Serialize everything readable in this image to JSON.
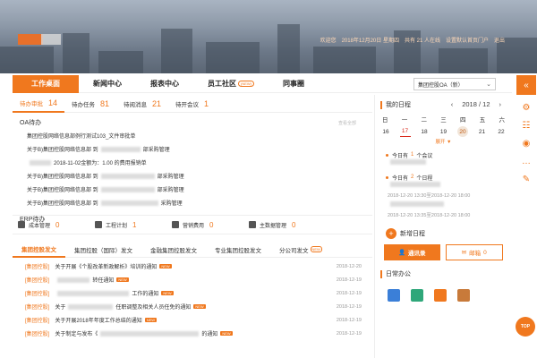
{
  "header": {
    "welcome": "欢迎您",
    "date": "2018年12月20日 星期四",
    "online": "共有 21 人在线",
    "set_home": "设置默认首页门户",
    "logout": "退出"
  },
  "nav": {
    "items": [
      "工作桌面",
      "新闻中心",
      "报表中心",
      "员工社区",
      "同事圈"
    ],
    "badge": "(NEW)",
    "org_select": "集团控股OA（新）"
  },
  "todo": {
    "tabs": [
      {
        "label": "待办审批",
        "count": "14"
      },
      {
        "label": "待办任务",
        "count": "81"
      },
      {
        "label": "待阅消息",
        "count": "21"
      },
      {
        "label": "待开会议",
        "count": "1"
      }
    ],
    "oa_title": "OA待办",
    "more": "查看全部",
    "oa_rows": [
      "集团控股网络信息部例行测试103_文件审批单",
      "关于B)集团控股网络信息部 到",
      "部采购管理",
      "2018-11-02金额为：1.00 的费用报销单",
      "关于B)集团控股网络信息部 到",
      "部采购管理",
      "关于B)集团控股网络信息部 到",
      "部采购管理",
      "关于B)集团控股网络信息部 到",
      "采购管理"
    ],
    "erp_title": "ERP待办"
  },
  "modules": [
    {
      "label": "成本管理",
      "count": "0"
    },
    {
      "label": "工程计划",
      "count": "1"
    },
    {
      "label": "营销费用",
      "count": "0"
    },
    {
      "label": "主数据管理",
      "count": "0"
    }
  ],
  "news": {
    "tabs": [
      "集团控股发文",
      "集团控股（国际）发文",
      "金融集团控股发文",
      "专业集团控股发文",
      "分公司发文"
    ],
    "new_tag": "NEW",
    "rows": [
      {
        "tag": "[集团控股]",
        "text": "关于开展《个股改革新政解析》培训的通知",
        "date": "2018-12-20"
      },
      {
        "tag": "[集团控股]",
        "text": "转任通知",
        "date": "2018-12-19"
      },
      {
        "tag": "[集团控股]",
        "text": "工作的通知",
        "date": "2018-12-19"
      },
      {
        "tag": "[集团控股]",
        "text": "关于",
        "text2": "任职调整及相关人员任免的通知",
        "date": "2018-12-19"
      },
      {
        "tag": "[集团控股]",
        "text": "关于开展2018年年度工作总结的通知",
        "date": "2018-12-19"
      },
      {
        "tag": "[集团控股]",
        "text": "关于制定与发布《",
        "text2": "的通知",
        "date": "2018-12-19"
      }
    ]
  },
  "schedule": {
    "title": "我的日程",
    "month": "2018 / 12",
    "weekdays": [
      "日",
      "一",
      "二",
      "三",
      "四",
      "五",
      "六"
    ],
    "days": [
      "16",
      "17",
      "18",
      "19",
      "20",
      "21",
      "22"
    ],
    "unfold": "展开 ▼",
    "today_label": "今日有",
    "today_count": "1",
    "today_unit": "个会议",
    "today2_label": "今日有",
    "today2_count": "2",
    "today2_unit": "个日程",
    "time1": "2018-12-20 13:30至2018-12-20 18:00",
    "time2": "2018-12-20 13:35至2018-12-20 18:00",
    "new_schedule": "新增日程"
  },
  "buttons": {
    "contacts": "通讯录",
    "mail": "邮箱",
    "mail_count": "0"
  },
  "daily_office": {
    "title": "日常办公",
    "colors": [
      "#3b7fd8",
      "#2fa77a",
      "#f0781e",
      "#c87a3a"
    ]
  },
  "top_button": "TOP",
  "accent": "#f0781e"
}
